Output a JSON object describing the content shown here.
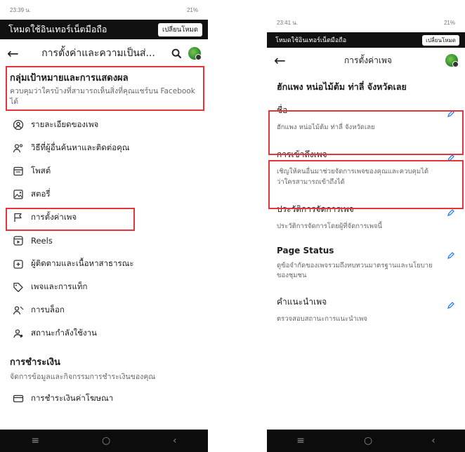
{
  "left": {
    "status": {
      "time": "23:39 น.",
      "right": "21%"
    },
    "modebar": {
      "title": "โหมดใช้อินเทอร์เน็ตมือถือ",
      "button": "เปลี่ยนโหมด"
    },
    "nav": {
      "title": "การตั้งค่าและความเป็นส่..."
    },
    "audience": {
      "title": "กลุ่มเป้าหมายและการแสดงผล",
      "desc": "ควบคุมว่าใครบ้างที่สามารถเห็นสิ่งที่คุณแชร์บน Facebook ได้"
    },
    "menu": [
      {
        "icon": "user-circle-icon",
        "label": "รายละเอียดของเพจ"
      },
      {
        "icon": "people-icon",
        "label": "วิธีที่ผู้อื่นค้นหาและติดต่อคุณ"
      },
      {
        "icon": "posts-icon",
        "label": "โพสต์"
      },
      {
        "icon": "stories-icon",
        "label": "สตอรี่"
      },
      {
        "icon": "flag-icon",
        "label": "การตั้งค่าเพจ"
      },
      {
        "icon": "reels-icon",
        "label": "Reels"
      },
      {
        "icon": "followers-icon",
        "label": "ผู้ติดตามและเนื้อหาสาธารณะ"
      },
      {
        "icon": "tag-icon",
        "label": "เพจและการแท็ก"
      },
      {
        "icon": "block-icon",
        "label": "การบล็อก"
      },
      {
        "icon": "active-status-icon",
        "label": "สถานะกำลังใช้งาน"
      }
    ],
    "payments": {
      "title": "การชำระเงิน",
      "desc": "จัดการข้อมูลและกิจกรรมการชำระเงินของคุณ",
      "item": "การชำระเงินค่าโฆษณา"
    }
  },
  "right": {
    "status": {
      "time": "23:41 น.",
      "right": "21%"
    },
    "modebar": {
      "title": "โหมดใช้อินเทอร์เน็ตมือถือ",
      "button": "เปลี่ยนโหมด"
    },
    "nav": {
      "title": "การตั้งค่าเพจ"
    },
    "page_name": "ฮักแพง หน่อไม้ต้ม ท่าลี่ จังหวัดเลย",
    "settings": [
      {
        "label": "ชื่อ",
        "value": "ฮักแพง หน่อไม้ต้ม ท่าลี่ จังหวัดเลย"
      },
      {
        "label": "การเข้าถึงเพจ",
        "value": "เชิญให้คนอื่นมาช่วยจัดการเพจของคุณและควบคุมได้ว่าใครสามารถเข้าถึงได้"
      },
      {
        "label": "ประวัติการจัดการเพจ",
        "value": "ประวัติการจัดการโดยผู้ที่จัดการเพจนี้"
      },
      {
        "label": "Page Status",
        "value": "ดูข้อจำกัดของเพจรวมถึงทบทวนมาตรฐานและนโยบายของชุมชน"
      },
      {
        "label": "คำแนะนำเพจ",
        "value": "ตรวจสอบสถานะการแนะนำเพจ"
      }
    ]
  },
  "colors": {
    "highlight": "#e5343a",
    "accent": "#1877f2"
  }
}
